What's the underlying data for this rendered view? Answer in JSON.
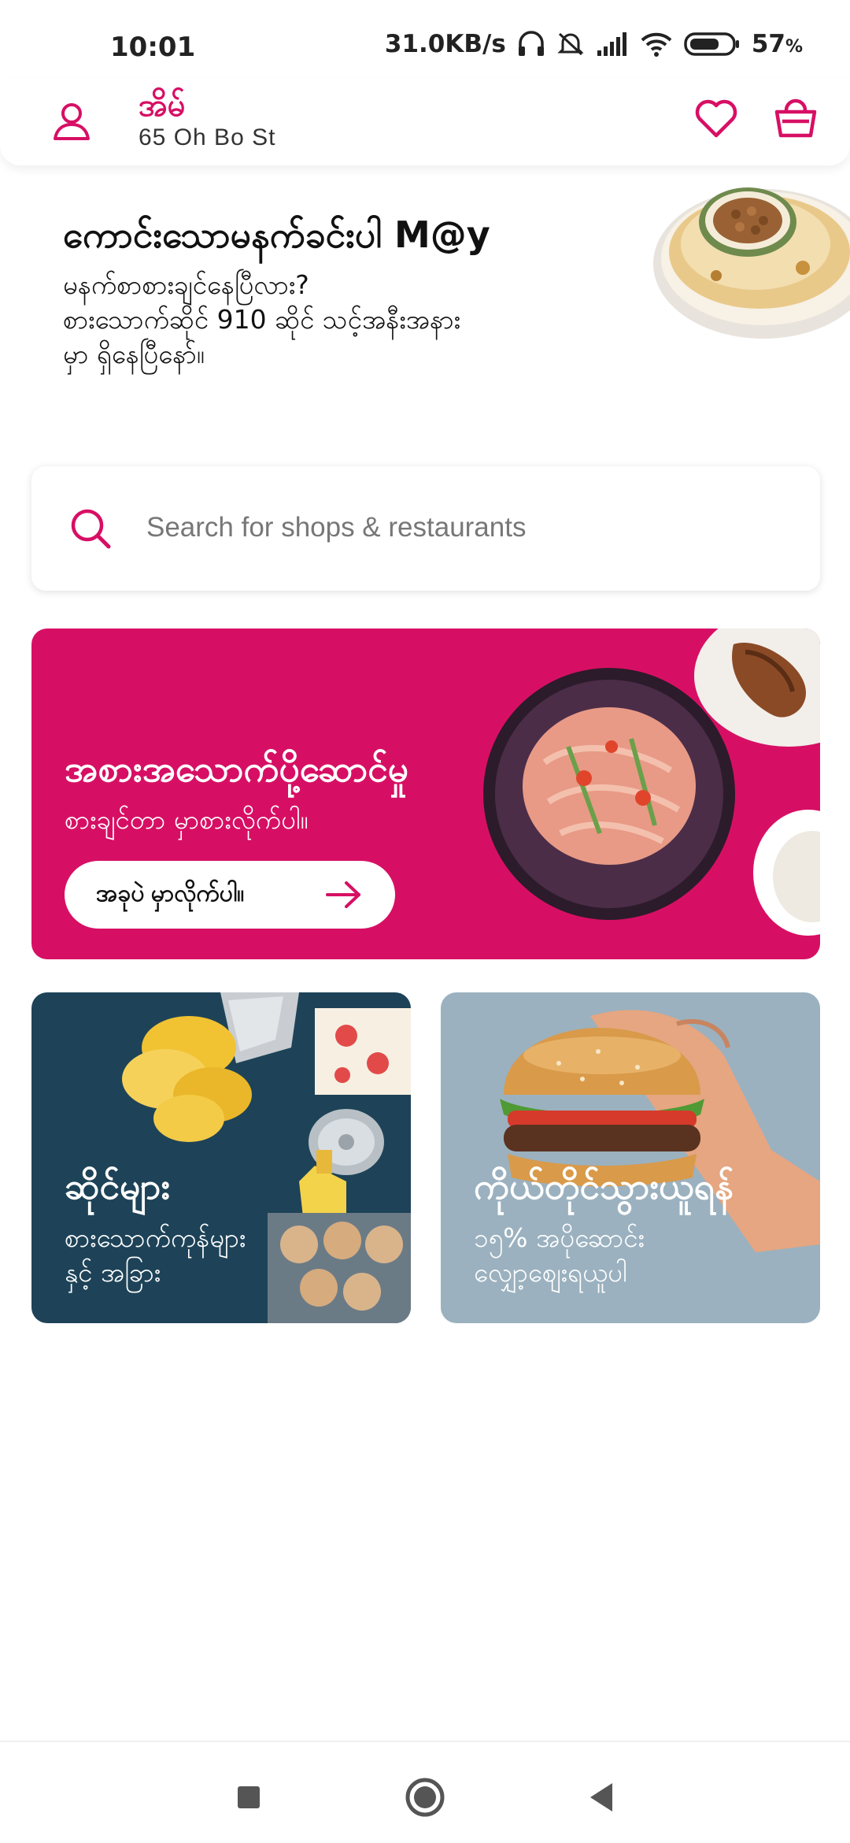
{
  "status_bar": {
    "time": "10:01",
    "net_speed": "31.0KB/s",
    "battery": "57",
    "battery_unit": "%"
  },
  "header": {
    "location_title": "အိမ်",
    "address": "65 Oh Bo St"
  },
  "greeting": {
    "title": "ကောင်းသောမနက်ခင်းပါ M@y",
    "line1": "မနက်စာစားချင်နေပြီလား?",
    "line2": "စားသောက်ဆိုင် 910 ဆိုင် သင့်အနီးအနား",
    "line3": "မှာ ရှိနေပြီနော်။"
  },
  "search": {
    "placeholder": "Search for shops & restaurants"
  },
  "delivery": {
    "title": "အစားအသောက်ပို့ဆောင်မှု",
    "subtitle": "စားချင်တာ မှာစားလိုက်ပါ။",
    "button_label": "အခုပဲ မှာလိုက်ပါ။"
  },
  "tiles": {
    "shops": {
      "title": "ဆိုင်များ",
      "line1": "စားသောက်ကုန်များ",
      "line2": "နှင့် အခြား"
    },
    "pickup": {
      "title": "ကိုယ်တိုင်သွားယူရန်",
      "line1": "၁၅% အပိုဆောင်း",
      "line2": "လျှော့စျေးရယူပါ"
    }
  },
  "colors": {
    "brand": "#d70f64",
    "shops_tile": "#1e4358",
    "pickup_tile": "#9bb1bf"
  }
}
